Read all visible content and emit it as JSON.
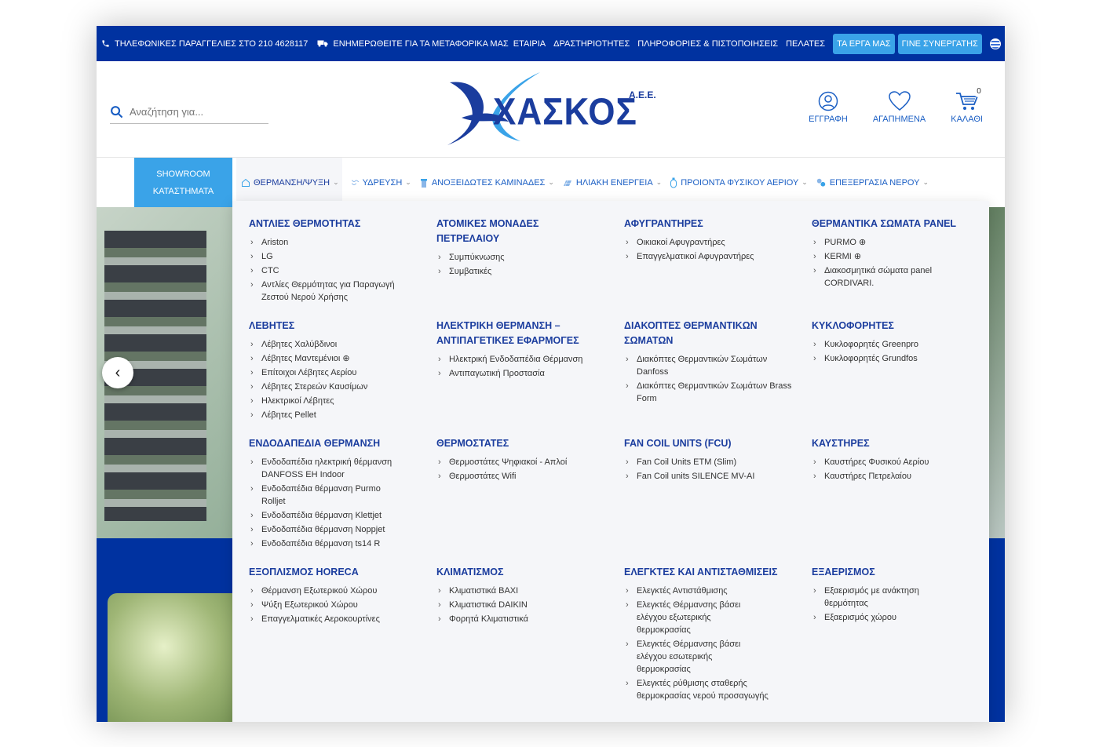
{
  "topbar": {
    "phone": "ΤΗΛΕΦΩΝΙΚΕΣ ΠΑΡΑΓΓΕΛΙΕΣ ΣΤΟ 210 4628117",
    "shipping": "ΕΝΗΜΕΡΩΘΕΙΤΕ ΓΙΑ ΤΑ ΜΕΤΑΦΟΡΙΚΑ ΜΑΣ",
    "links": [
      "ΕΤΑΙΡΙΑ",
      "ΔΡΑΣΤΗΡΙΟΤΗΤΕΣ",
      "ΠΛΗΡΟΦΟΡΙΕΣ & ΠΙΣΤΟΠΟΙΗΣΕΙΣ",
      "ΠΕΛΑΤΕΣ"
    ],
    "projects": "ΤΑ ΕΡΓΑ ΜΑΣ",
    "partner": "ΓΙΝΕ ΣΥΝΕΡΓΑΤΗΣ",
    "bg_color": "#0032a0",
    "pill_color": "#3aa3e8"
  },
  "header": {
    "search_placeholder": "Αναζήτηση για...",
    "logo_text": "ΧΑΣΚΟΣ",
    "logo_suffix": "Α.Ε.Ε.",
    "register": "ΕΓΓΡΑΦΗ",
    "favorites": "ΑΓΑΠΗΜΕΝΑ",
    "cart": "ΚΑΛΑΘΙ",
    "cart_count": "0"
  },
  "nav": {
    "showroom_line1": "SHOWROOM",
    "showroom_line2": "ΚΑΤΑΣΤΗΜΑΤΑ",
    "items": [
      {
        "label": "ΘΕΡΜΑΝΣΗ/ΨΥΞΗ",
        "icon": "home-icon"
      },
      {
        "label": "ΥΔΡΕΥΣΗ",
        "icon": "water-icon"
      },
      {
        "label": "ΑΝΟΞΕΙΔΩΤΕΣ ΚΑΜΙΝΑΔΕΣ",
        "icon": "chimney-icon"
      },
      {
        "label": "ΗΛΙΑΚΗ ΕΝΕΡΓΕΙΑ",
        "icon": "solar-icon"
      },
      {
        "label": "ΠΡΟΙΟΝΤΑ ΦΥΣΙΚΟΥ ΑΕΡΙΟΥ",
        "icon": "gas-icon"
      },
      {
        "label": "ΕΠΕΞΕΡΓΑΣΙΑ ΝΕΡΟΥ",
        "icon": "water-treatment-icon"
      }
    ]
  },
  "mega": {
    "sections": [
      {
        "title": "ΑΝΤΛΙΕΣ ΘΕΡΜΟΤΗΤΑΣ",
        "items": [
          "Ariston",
          "LG",
          "CTC",
          "Αντλίες Θερμότητας για Παραγωγή Ζεστού Νερού Χρήσης"
        ]
      },
      {
        "title": "ΑΤΟΜΙΚΕΣ ΜΟΝΑΔΕΣ ΠΕΤΡΕΛΑΙΟΥ",
        "items": [
          "Συμπύκνωσης",
          "Συμβατικές"
        ]
      },
      {
        "title": "ΑΦΥΓΡΑΝΤΗΡΕΣ",
        "items": [
          "Οικιακοί Αφυγραντήρες",
          "Επαγγελματικοί Αφυγραντήρες"
        ]
      },
      {
        "title": "ΘΕΡΜΑΝΤΙΚΑ ΣΩΜΑΤΑ PANEL",
        "items": [
          "PURMO ⊕",
          "KERMI ⊕",
          "Διακοσμητικά σώματα panel CORDIVARI."
        ]
      },
      {
        "title": "ΛΕΒΗΤΕΣ",
        "items": [
          "Λέβητες Χαλύβδινοι",
          "Λέβητες Μαντεμένιοι ⊕",
          "Επίτοιχοι Λέβητες Αερίου",
          "Λέβητες Στερεών Καυσίμων",
          "Ηλεκτρικοί Λέβητες",
          "Λέβητες Pellet"
        ]
      },
      {
        "title": "ΗΛΕΚΤΡΙΚΗ ΘΕΡΜΑΝΣΗ – ΑΝΤΙΠΑΓΕΤΙΚΕΣ ΕΦΑΡΜΟΓΕΣ",
        "items": [
          "Ηλεκτρική Ενδοδαπέδια Θέρμανση",
          "Αντιπαγωτική Προστασία"
        ]
      },
      {
        "title": "ΔΙΑΚΟΠΤΕΣ ΘΕΡΜΑΝΤΙΚΩΝ ΣΩΜΑΤΩΝ",
        "items": [
          "Διακόπτες Θερμαντικών Σωμάτων Danfoss",
          "Διακόπτες Θερμαντικών Σωμάτων Brass Form"
        ]
      },
      {
        "title": "ΚΥΚΛΟΦΟΡΗΤΕΣ",
        "items": [
          "Κυκλοφορητές Greenpro",
          "Κυκλοφορητές Grundfos"
        ]
      },
      {
        "title": "ΕΝΔΟΔΑΠΕΔΙΑ ΘΕΡΜΑΝΣΗ",
        "items": [
          "Ενδοδαπέδια ηλεκτρική θέρμανση DANFOSS EH Indoor",
          "Ενδοδαπέδια θέρμανση Purmo Rolljet",
          "Ενδοδαπέδια θέρμανση Klettjet",
          "Ενδοδαπέδια θέρμανση Noppjet",
          "Ενδοδαπέδια θέρμανση ts14 R"
        ]
      },
      {
        "title": "ΘΕΡΜΟΣΤΑΤΕΣ",
        "items": [
          "Θερμοστάτες Ψηφιακοί - Απλοί",
          "Θερμοστάτες Wifi"
        ]
      },
      {
        "title": "FAN COIL UNITS (FCU)",
        "items": [
          "Fan Coil Units ETM (Slim)",
          "Fan Coil units SILENCE MV-AI"
        ]
      },
      {
        "title": "ΚΑΥΣΤΗΡΕΣ",
        "items": [
          "Καυστήρες Φυσικού Αερίου",
          "Καυστήρες Πετρελαίου"
        ]
      },
      {
        "title": "ΕΞΟΠΛΙΣΜΟΣ HORECA",
        "items": [
          "Θέρμανση Εξωτερικού Χώρου",
          "Ψύξη Εξωτερικού Χώρου",
          "Επαγγελματικές Αεροκουρτίνες"
        ]
      },
      {
        "title": "ΚΛΙΜΑΤΙΣΜΟΣ",
        "items": [
          "Κλιματιστικά BAXI",
          "Κλιματιστικά DAIKIN",
          "Φορητά Κλιματιστικά"
        ]
      },
      {
        "title": "ΕΛΕΓΚΤΕΣ ΚΑΙ ΑΝΤΙΣΤΑΘΜΙΣΕΙΣ",
        "items": [
          "Ελεγκτές Αντιστάθμισης",
          "Ελεγκτές Θέρμανσης βάσει ελέγχου εξωτερικής θερμοκρασίας",
          "Ελεγκτές Θέρμανσης βάσει ελέγχου εσωτερικής θερμοκρασίας",
          "Ελεγκτές ρύθμισης σταθερής θερμοκρασίας νερού προσαγωγής"
        ]
      },
      {
        "title": "ΕΞΑΕΡΙΣΜΟΣ",
        "items": [
          "Εξαερισμός με ανάκτηση θερμότητας",
          "Εξαερισμός χώρου"
        ]
      }
    ]
  }
}
